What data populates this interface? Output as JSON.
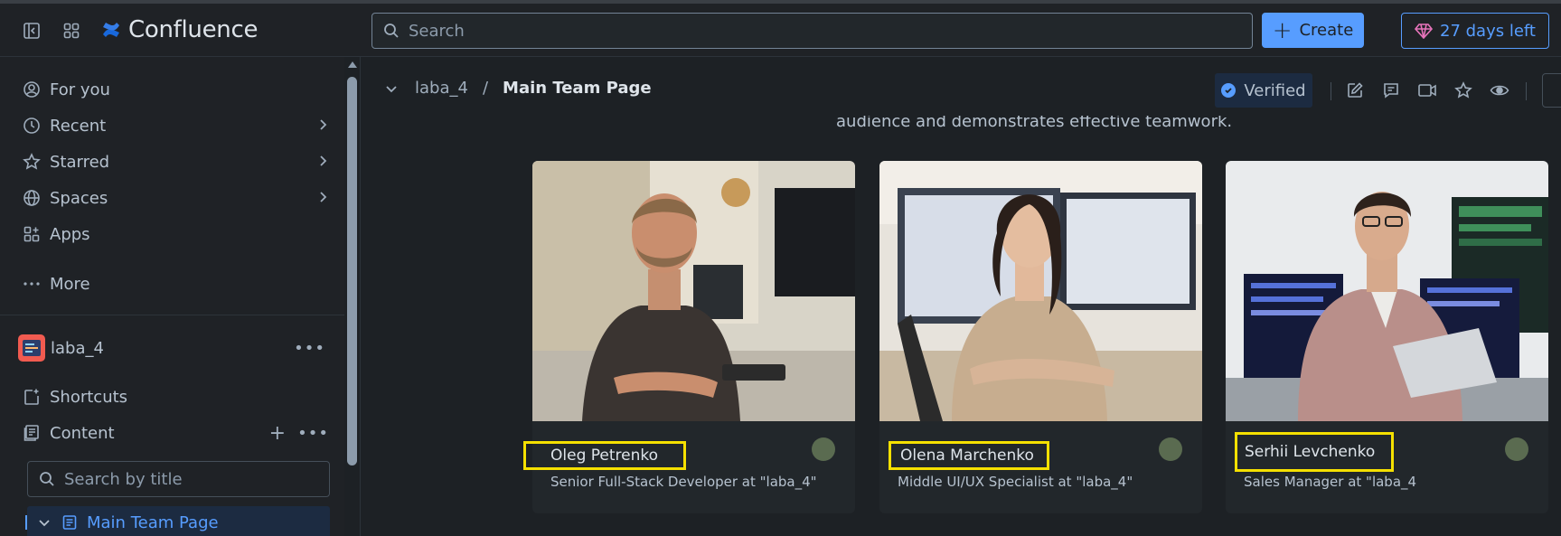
{
  "header": {
    "app_name": "Confluence",
    "search_placeholder": "Search",
    "create_label": "Create",
    "trial_label": "27 days left",
    "accent_color": "#579dff"
  },
  "sidebar": {
    "nav": [
      {
        "label": "For you",
        "icon": "person-circle-icon"
      },
      {
        "label": "Recent",
        "icon": "clock-icon"
      },
      {
        "label": "Starred",
        "icon": "star-icon"
      },
      {
        "label": "Spaces",
        "icon": "globe-icon"
      },
      {
        "label": "Apps",
        "icon": "apps-icon"
      },
      {
        "label": "More",
        "icon": "more-icon"
      }
    ],
    "space_name": "laba_4",
    "shortcuts_label": "Shortcuts",
    "content_label": "Content",
    "search_placeholder": "Search by title",
    "current_page": "Main Team Page"
  },
  "main": {
    "breadcrumb": {
      "space": "laba_4",
      "separator": "/",
      "page": "Main Team Page"
    },
    "verified_label": "Verified",
    "intro_text": "audience and demonstrates effective teamwork.",
    "team": [
      {
        "name": "Oleg Petrenko",
        "role": "Senior Full-Stack Developer at \"laba_4\""
      },
      {
        "name": "Olena Marchenko",
        "role": "Middle UI/UX Specialist at \"laba_4\""
      },
      {
        "name": "Serhii Levchenko",
        "role": "Sales Manager at \"laba_4"
      }
    ]
  }
}
